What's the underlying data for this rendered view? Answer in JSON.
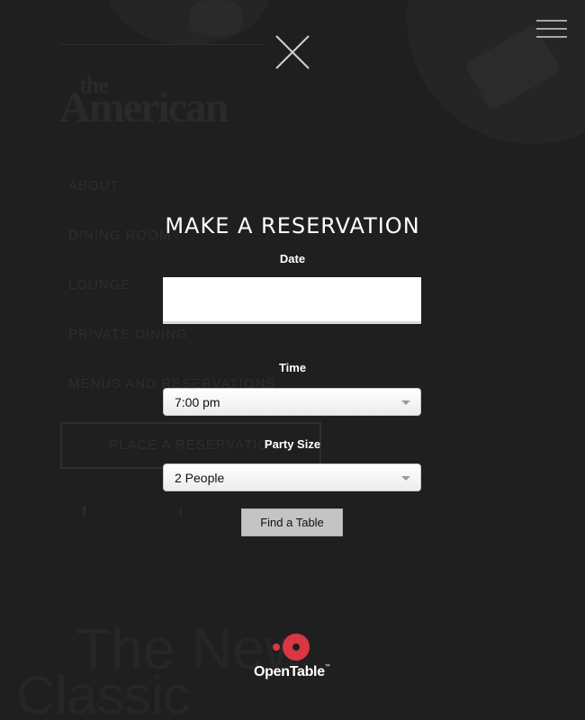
{
  "background": {
    "logo_small": "the",
    "logo": "American",
    "nav": [
      "ABOUT",
      "DINING ROOM",
      "LOUNGE",
      "PRIVATE DINING",
      "MENUS AND RESERVATIONS"
    ],
    "reserve_button": "PLACE A RESERVATION",
    "social": {
      "facebook": "f",
      "twitter": "t"
    },
    "tagline_line1": "The New",
    "tagline_line2": "Classic"
  },
  "header": {
    "menu_icon": "hamburger-menu-icon",
    "close_icon": "close-icon"
  },
  "reservation": {
    "title": "MAKE A RESERVATION",
    "date_label": "Date",
    "date_value": "",
    "time_label": "Time",
    "time_value": "7:00 pm",
    "party_label": "Party Size",
    "party_value": "2 People",
    "submit_label": "Find a Table"
  },
  "brand": {
    "name": "OpenTable",
    "trademark": "™",
    "accent_color": "#da3743"
  }
}
